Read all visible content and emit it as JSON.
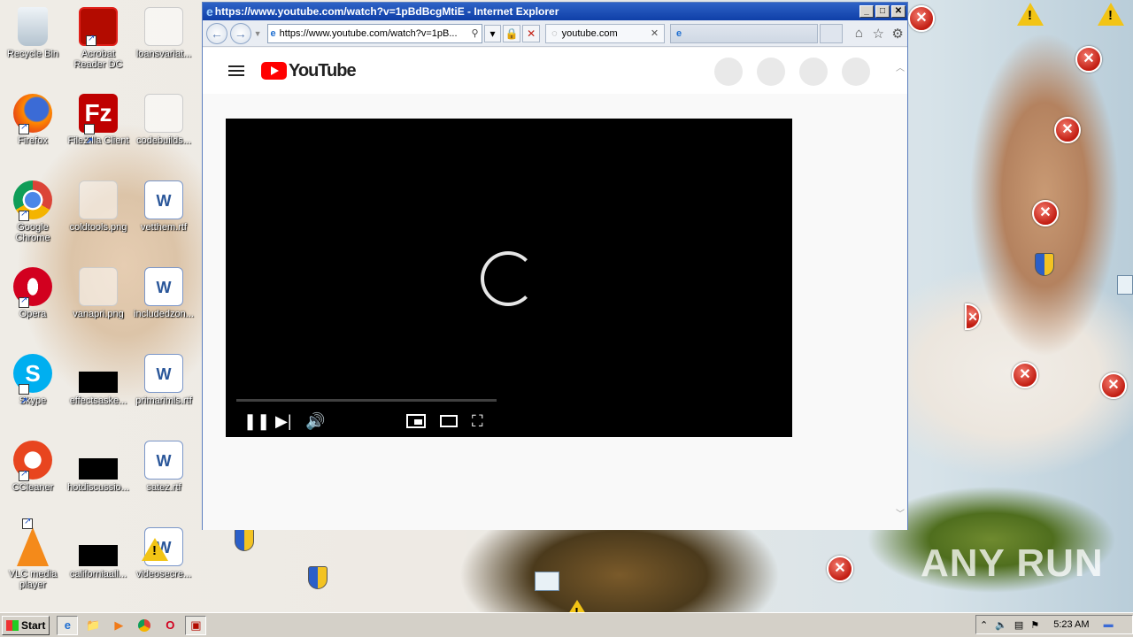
{
  "desktop": {
    "icons": [
      {
        "label": "Recycle Bin"
      },
      {
        "label": "Acrobat Reader DC"
      },
      {
        "label": "loansvariat..."
      },
      {
        "label": "Firefox"
      },
      {
        "label": "FileZilla Client"
      },
      {
        "label": "codebuilds..."
      },
      {
        "label": "Google Chrome"
      },
      {
        "label": "coldtools.png"
      },
      {
        "label": "vetthem.rtf"
      },
      {
        "label": "Opera"
      },
      {
        "label": "vanapri.png"
      },
      {
        "label": "includedzon..."
      },
      {
        "label": "Skype"
      },
      {
        "label": "effectsaske..."
      },
      {
        "label": "primarimls.rtf"
      },
      {
        "label": "CCleaner"
      },
      {
        "label": "hotdiscussio..."
      },
      {
        "label": "satez.rtf"
      },
      {
        "label": "VLC media player"
      },
      {
        "label": "californiaall..."
      },
      {
        "label": "videosecre..."
      }
    ],
    "watermark": "ANY RUN"
  },
  "ie": {
    "title": "https://www.youtube.com/watch?v=1pBdBcgMtiE - Internet Explorer",
    "address": "https://www.youtube.com/watch?v=1pB...",
    "tab_label": "youtube.com",
    "buttons": {
      "min": "_",
      "max": "□",
      "close": "✕"
    }
  },
  "youtube": {
    "logo_text": "YouTube"
  },
  "player": {
    "state": "loading",
    "progress": 0
  },
  "taskbar": {
    "start": "Start",
    "clock": "5:23 AM"
  },
  "colors": {
    "titlebar": "#0f3fa8",
    "youtube_red": "#ff0000",
    "error_badge": "#c21d12",
    "warning": "#f2c415"
  }
}
